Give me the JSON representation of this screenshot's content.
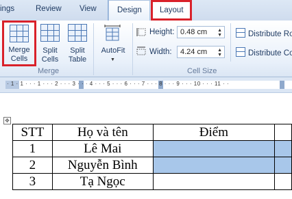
{
  "tabs": {
    "mailings_partial": "ings",
    "review": "Review",
    "view": "View",
    "design": "Design",
    "layout": "Layout"
  },
  "ribbon": {
    "merge_group": {
      "label": "Merge",
      "merge_cells": [
        "Merge",
        "Cells"
      ],
      "split_cells": [
        "Split",
        "Cells"
      ],
      "split_table": [
        "Split",
        "Table"
      ]
    },
    "autofit": {
      "label": "AutoFit"
    },
    "cell_size_group": {
      "label": "Cell Size",
      "height_label": "Height:",
      "height_value": "0.48 cm",
      "width_label": "Width:",
      "width_value": "4.24 cm",
      "distribute_rows": "Distribute Ro",
      "distribute_cols": "Distribute Co"
    }
  },
  "ruler": {
    "marks": "· 1 · 1 · · · 1 · · · 2 · · · 3 · · · 4 · · · 5 · · · 6 · · · 7 · · · 8 · · · 9 · · · 10 · · · 11 · ·"
  },
  "table": {
    "headers": [
      "STT",
      "Họ và tên",
      "Điểm",
      ""
    ],
    "rows": [
      [
        "1",
        "Lê Mai",
        "",
        ""
      ],
      [
        "2",
        "Nguyễn Bình",
        "",
        ""
      ],
      [
        "3",
        "Tạ Ngọc",
        "",
        ""
      ]
    ],
    "selected_color": "#a8c7ea"
  },
  "colors": {
    "highlight_border": "#d9212a",
    "ribbon_text": "#1f3b63"
  }
}
